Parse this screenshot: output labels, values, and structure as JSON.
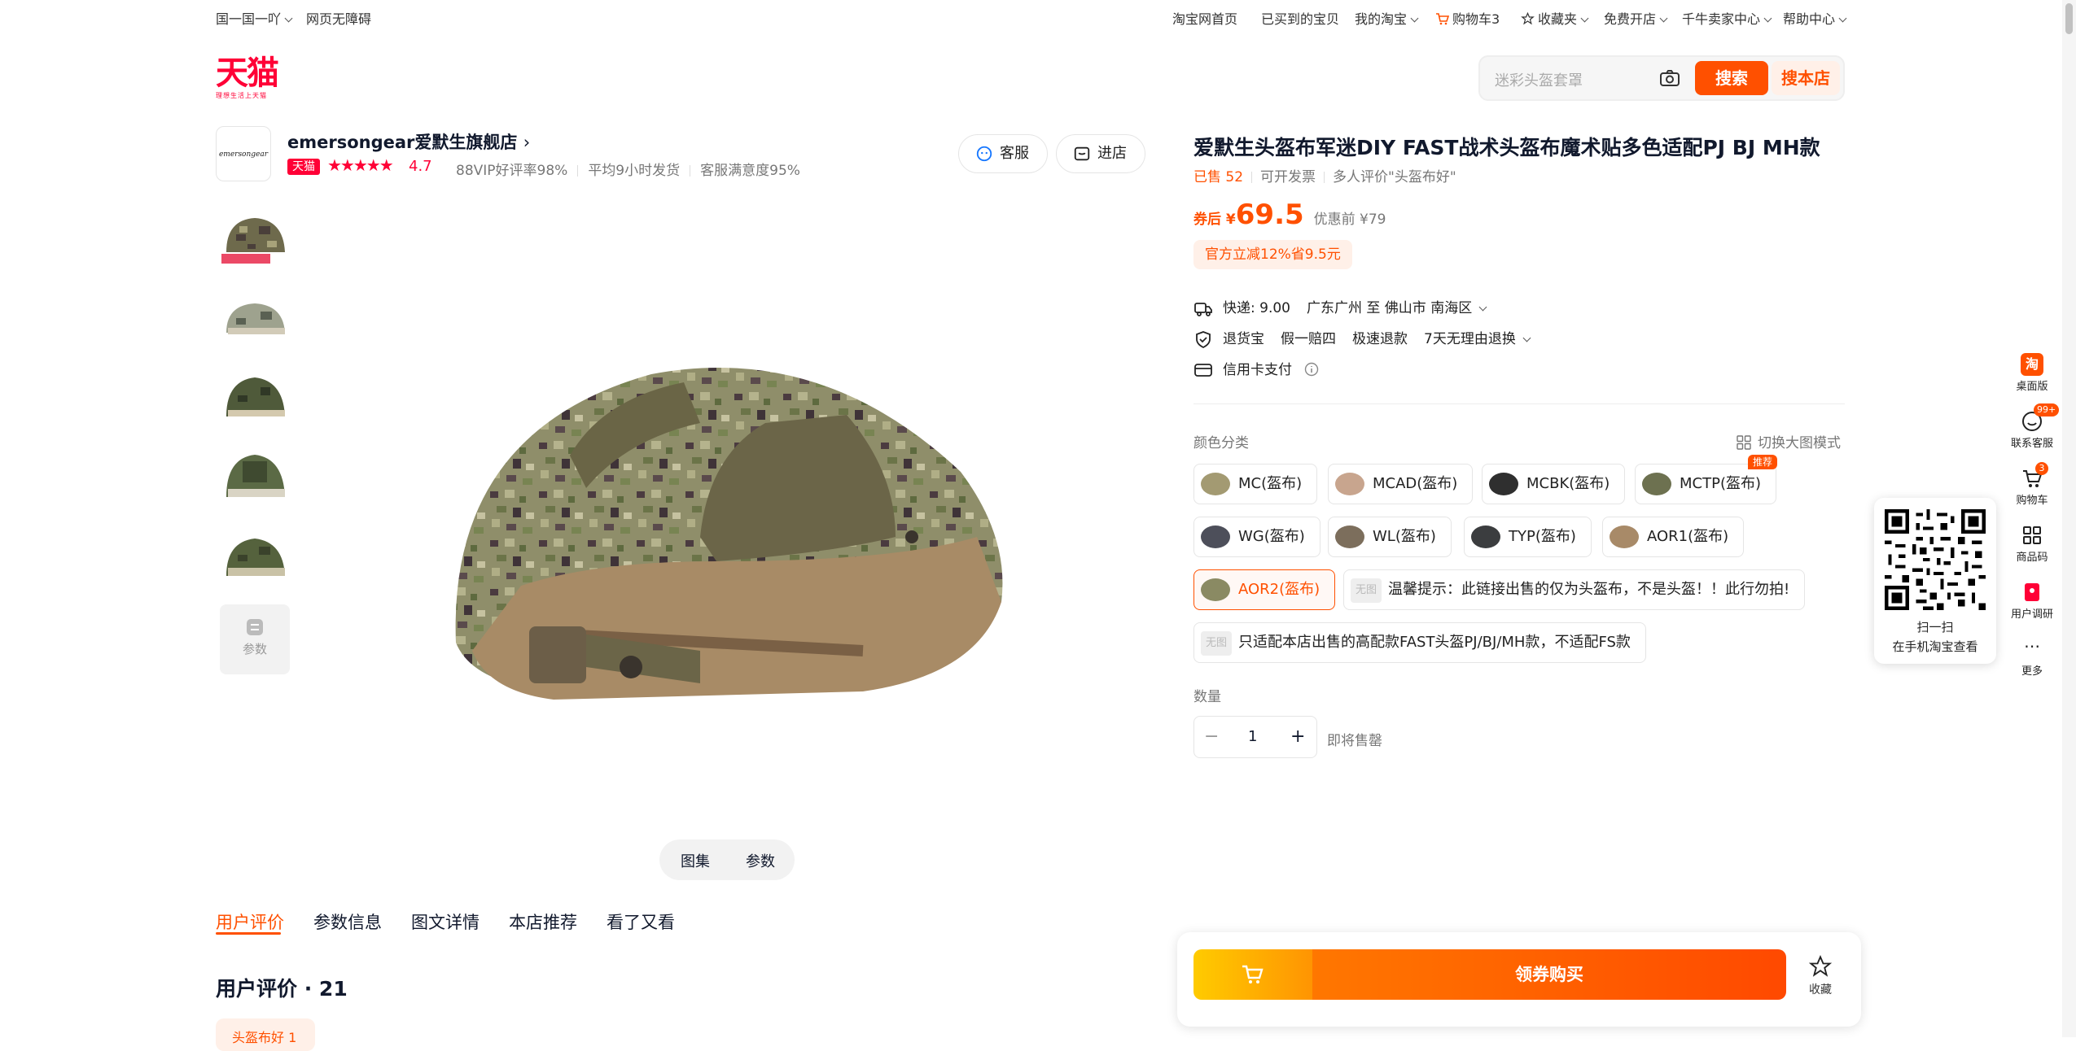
{
  "topbar": {
    "region": "国一国一吖",
    "accessibility": "网页无障碍",
    "links": [
      "淘宝网首页",
      "已买到的宝贝",
      "我的淘宝",
      "购物车3",
      "收藏夹",
      "免费开店",
      "千牛卖家中心",
      "帮助中心"
    ]
  },
  "brand": {
    "logo_text": "天猫",
    "logo_sub": "理想生活上天猫"
  },
  "search": {
    "placeholder": "迷彩头盔套罩",
    "search_label": "搜索",
    "shop_search_label": "搜本店"
  },
  "shop": {
    "logo_text": "emersongear",
    "name": "emersongear爱默生旗舰店",
    "badge": "天猫",
    "stars": "★★★★★",
    "rating": "4.7",
    "metrics": [
      "88VIP好评率98%",
      "平均9小时发货",
      "客服满意度95%"
    ],
    "service_label": "客服",
    "enter_label": "进店"
  },
  "gallery": {
    "param_thumb_label": "参数",
    "btn_gallery": "图集",
    "btn_params": "参数"
  },
  "tabs": [
    "用户评价",
    "参数信息",
    "图文详情",
    "本店推荐",
    "看了又看"
  ],
  "reviews": {
    "title": "用户评价",
    "count": "21",
    "chip": "头盔布好 1"
  },
  "product": {
    "title": "爱默生头盔布军迷DIY FAST战术头盔布魔术贴多色适配PJ BJ MH款",
    "sold": "已售 52",
    "invoice": "可开发票",
    "review_hint": "多人评价\"头盔布好\"",
    "price_label": "券后 ¥",
    "price": "69.5",
    "orig_price": "优惠前 ¥79",
    "promo": "官方立减12%省9.5元"
  },
  "services": {
    "shipping": "快递: 9.00",
    "route": "广东广州 至 佛山市 南海区",
    "return_insurance": "退货宝",
    "fake_comp": "假一赔四",
    "fast_refund": "极速退款",
    "no_reason": "7天无理由退换",
    "credit": "信用卡支付"
  },
  "sku": {
    "label": "颜色分类",
    "switch_mode": "切换大图模式",
    "options": [
      "MC(盔布)",
      "MCAD(盔布)",
      "MCBK(盔布)",
      "MCTP(盔布)",
      "WG(盔布)",
      "WL(盔布)",
      "TYP(盔布)",
      "AOR1(盔布)",
      "AOR2(盔布)",
      "温馨提示：此链接出售的仅为头盔布，不是头盔！！此行勿拍!",
      "只适配本店出售的高配款FAST头盔PJ/BJ/MH款，不适配FS款"
    ],
    "recommend_tag": "推荐",
    "na_label": "无图",
    "selected": "AOR2(盔布)"
  },
  "quantity": {
    "label": "数量",
    "value": "1",
    "status": "即将售罄"
  },
  "buy": {
    "buy_label": "领券购买",
    "fav_label": "收藏"
  },
  "qr": {
    "line1": "扫一扫",
    "line2": "在手机淘宝查看"
  },
  "sidebar": {
    "items": [
      "桌面版",
      "联系客服",
      "购物车",
      "商品码",
      "用户调研",
      "更多"
    ],
    "service_badge": "99+",
    "cart_badge": "3"
  },
  "colors": {
    "accent": "#ff5000",
    "tmall": "#ff0036"
  }
}
